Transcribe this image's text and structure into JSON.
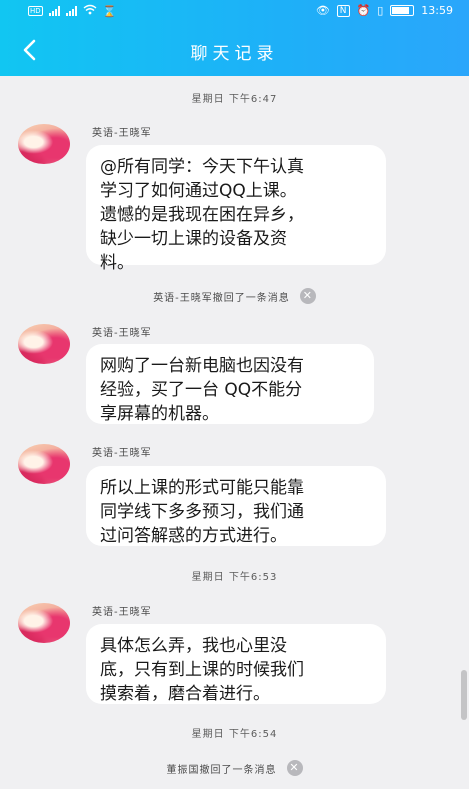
{
  "status_bar": {
    "network_label": "4G",
    "time": "13:59"
  },
  "header": {
    "title": "聊天记录"
  },
  "timestamps": [
    "星期日 下午6:47",
    "星期日 下午6:53",
    "星期日 下午6:54"
  ],
  "messages": [
    {
      "sender": "英语-王晓军",
      "lines": [
        "@所有同学：今天下午认真",
        "学习了如何通过QQ上课。",
        "遗憾的是我现在困在异乡，",
        "缺少一切上课的设备及资",
        "料。"
      ]
    },
    {
      "sender": "英语-王晓军",
      "lines": [
        "网购了一台新电脑也因没有",
        "经验，买了一台 QQ不能分",
        "享屏幕的机器。"
      ]
    },
    {
      "sender": "英语-王晓军",
      "lines": [
        "所以上课的形式可能只能靠",
        "同学线下多多预习，我们通",
        "过问答解惑的方式进行。"
      ]
    },
    {
      "sender": "英语-王晓军",
      "lines": [
        "具体怎么弄，我也心里没",
        "底，只有到上课的时候我们",
        "摸索着，磨合着进行。"
      ]
    }
  ],
  "recall_notices": [
    "英语-王晓军撤回了一条消息",
    "董振国撤回了一条消息"
  ],
  "colors": {
    "header_start": "#11c6f2",
    "header_end": "#2aa6fb",
    "background": "#f0f0f2",
    "bubble": "#ffffff"
  }
}
